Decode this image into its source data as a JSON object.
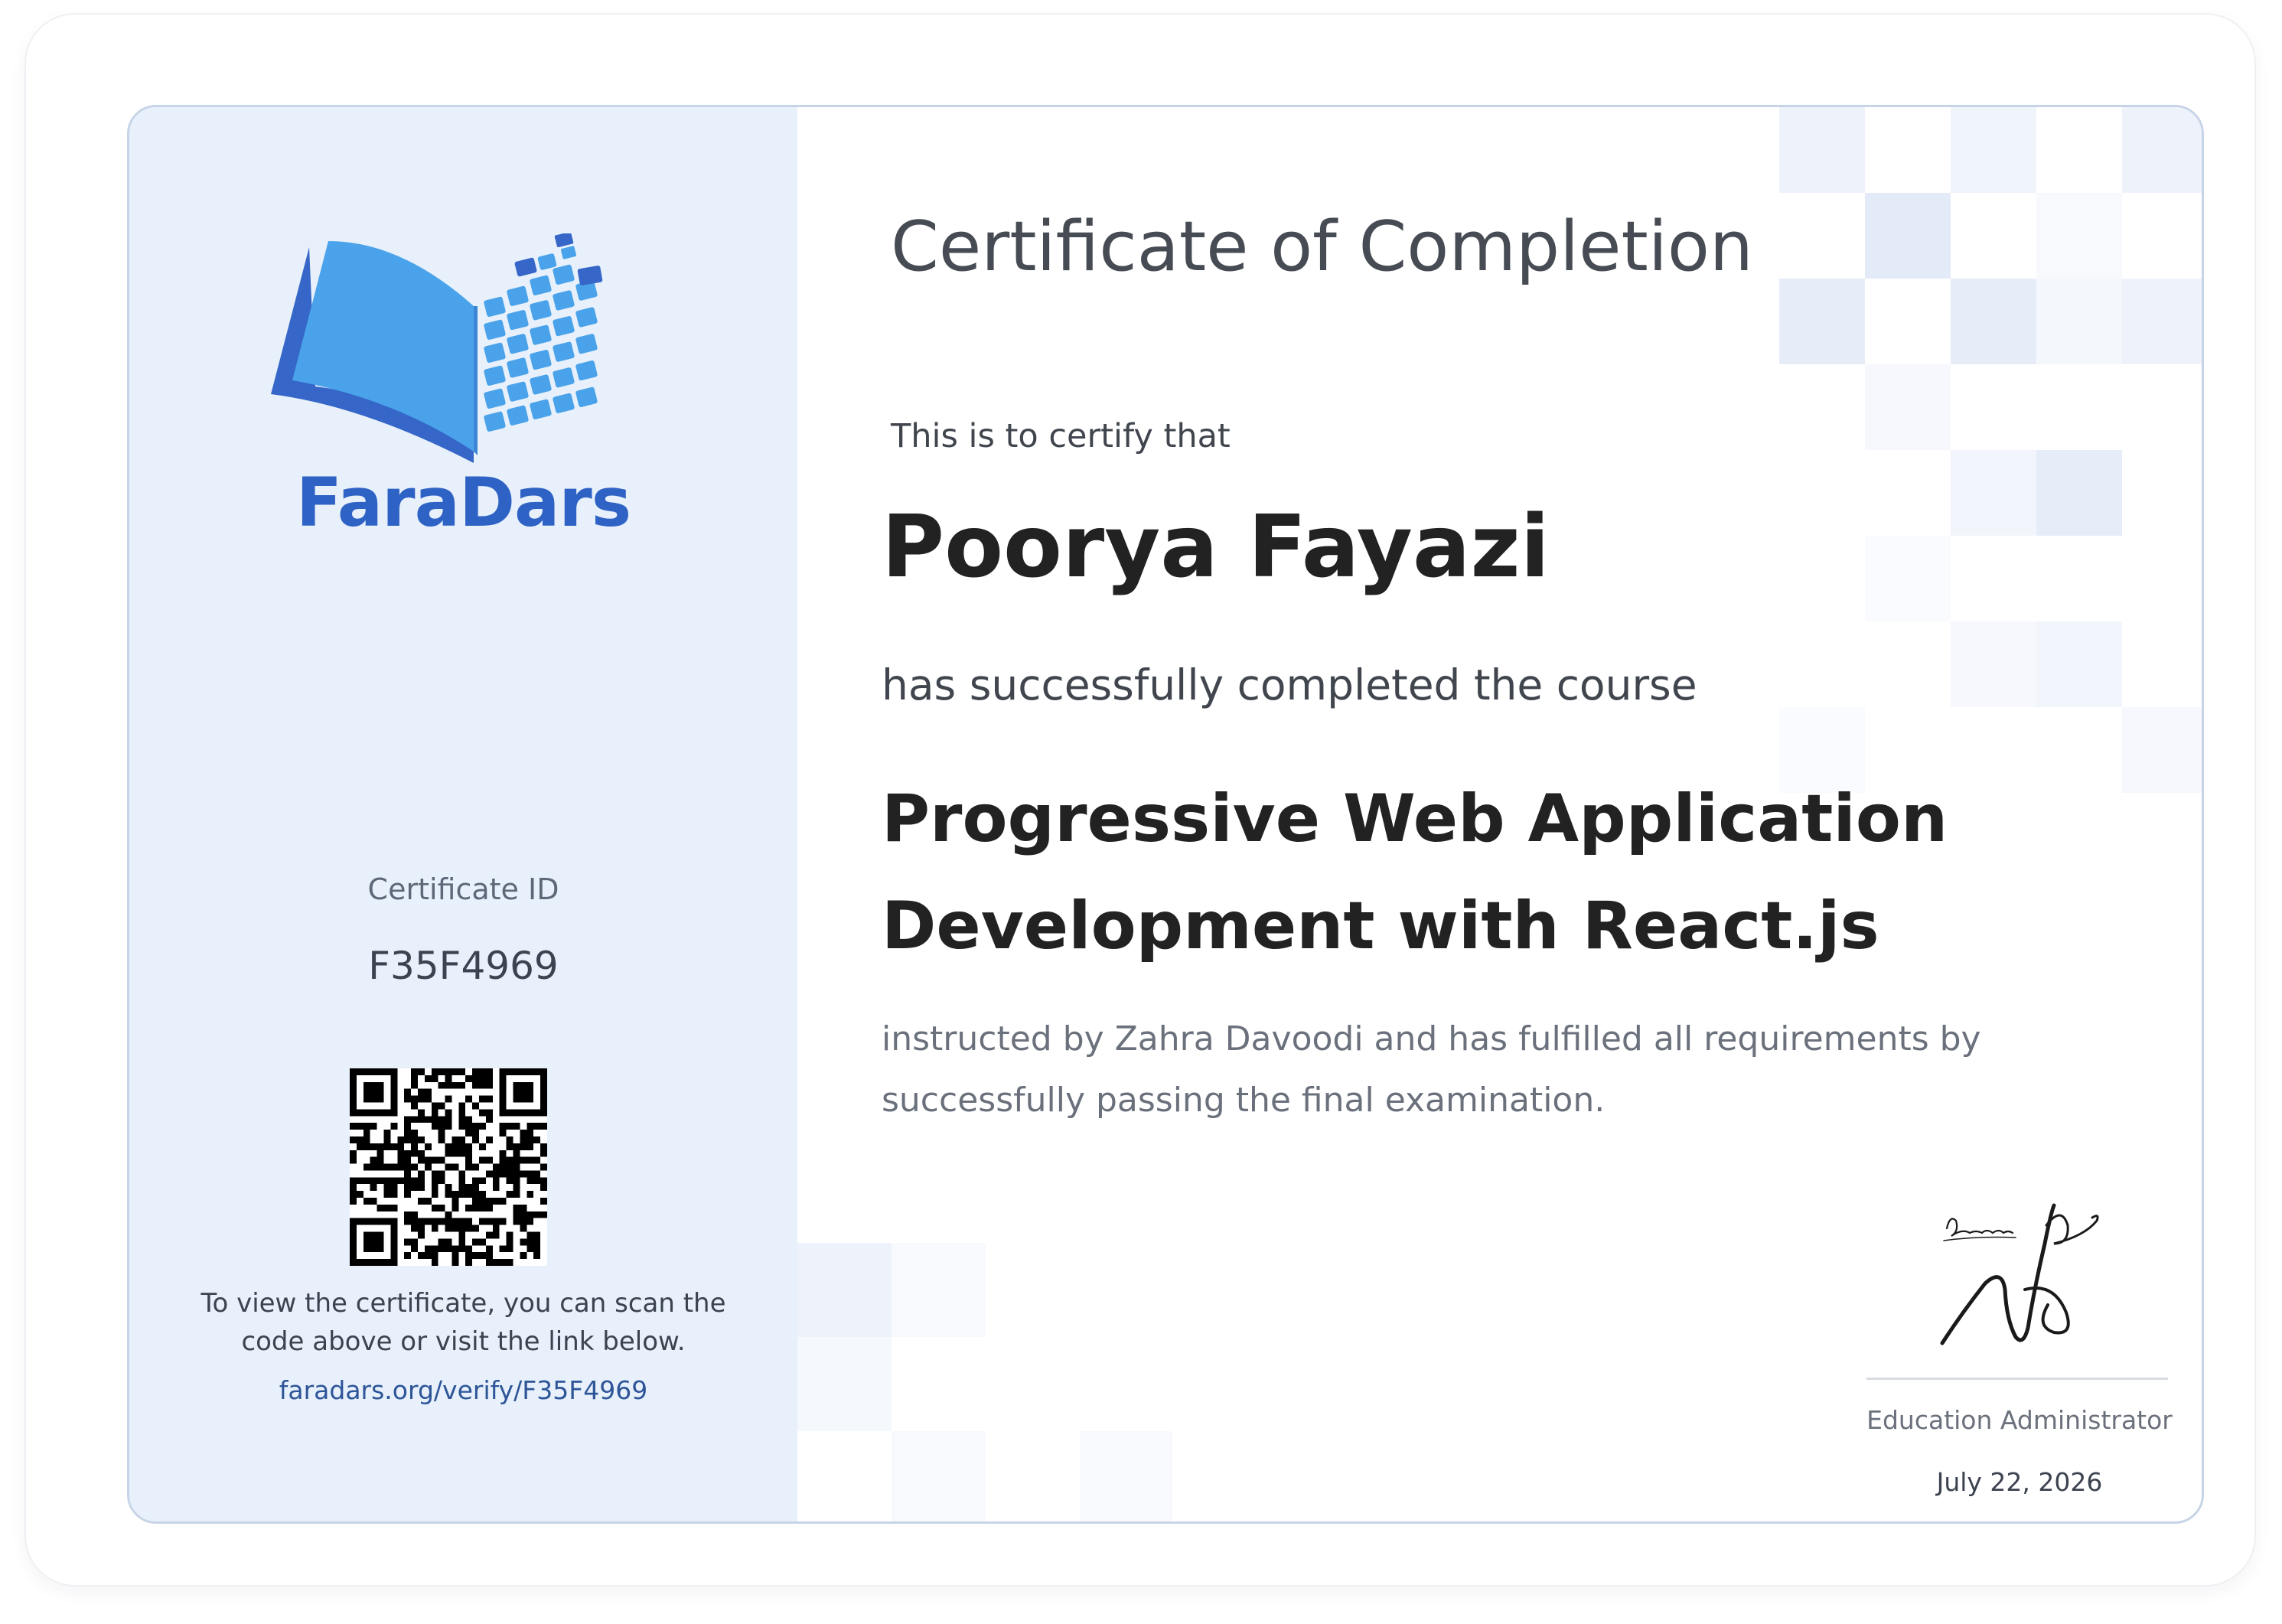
{
  "brand": {
    "name": "FaraDars",
    "logo_icon": "open-book-grid-icon",
    "colors": {
      "primary": "#2e62c4",
      "light": "#4aa3ea",
      "panel": "#e7f0fb"
    }
  },
  "certificate": {
    "title": "Certificate of Completion",
    "certify_intro": "This is to certify that",
    "recipient_name": "Poorya Fayazi",
    "completed_text": "has successfully completed the course",
    "course_title": "Progressive Web Application Development with React.js",
    "instructed_text": "instructed by Zahra Davoodi and has fulfilled all requirements by successfully passing the final examination."
  },
  "sidebar": {
    "id_label": "Certificate ID",
    "id_value": "F35F4969",
    "scan_text": "To view the certificate, you can scan the code above or visit the link below.",
    "verify_link": "faradars.org/verify/F35F4969",
    "qr_icon": "qr-code-icon"
  },
  "signature": {
    "role": "Education Administrator",
    "date": "July 22, 2026",
    "signature_icon": "handwritten-signature-icon"
  }
}
